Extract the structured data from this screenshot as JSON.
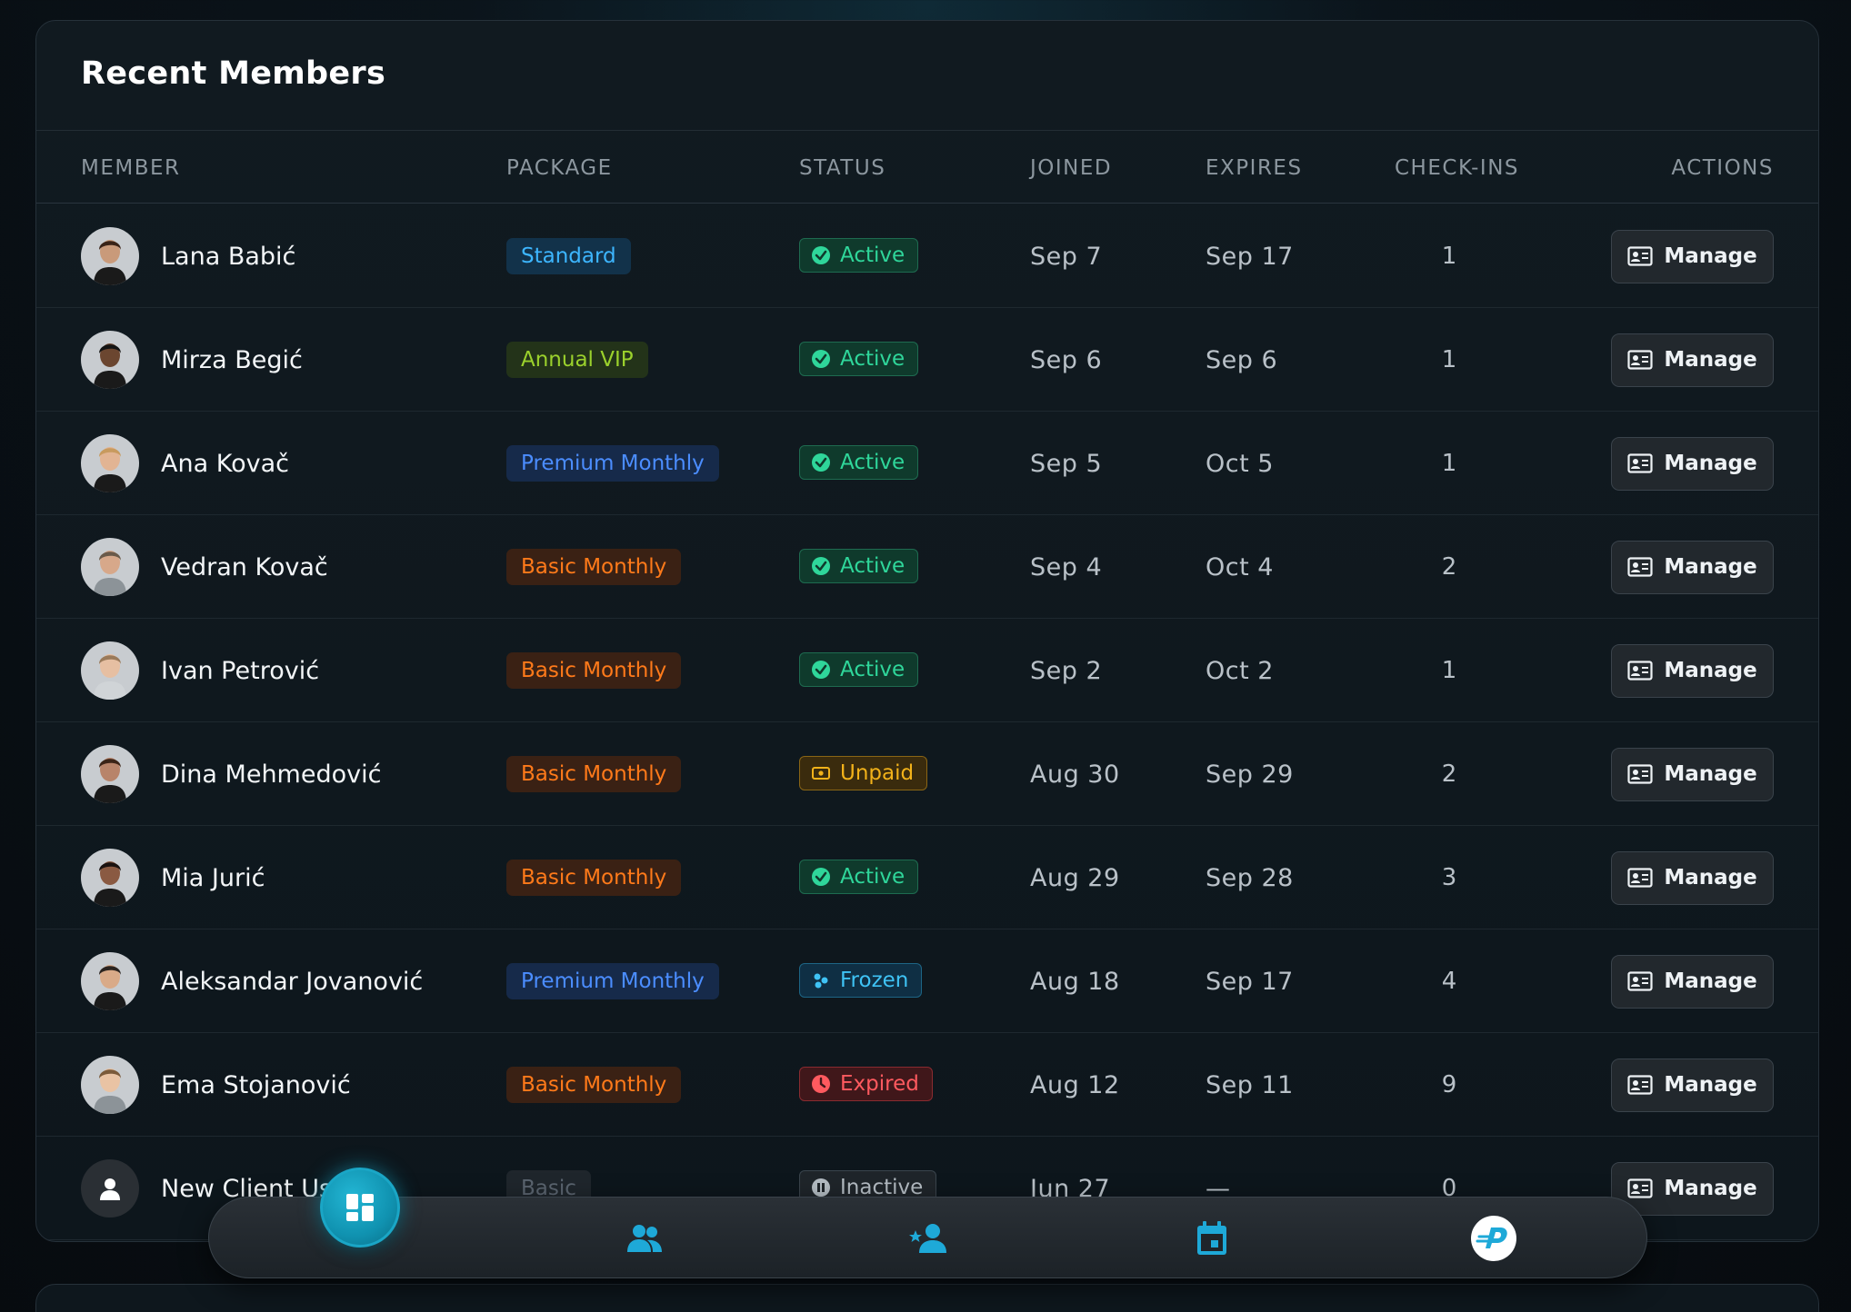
{
  "card": {
    "title": "Recent Members"
  },
  "columns": {
    "member": "MEMBER",
    "package": "PACKAGE",
    "status": "STATUS",
    "joined": "JOINED",
    "expires": "EXPIRES",
    "checkins": "CHECK-INS",
    "actions": "ACTIONS"
  },
  "rows": [
    {
      "name": "Lana Babić",
      "package": "Standard",
      "package_kind": "standard",
      "status": "Active",
      "status_kind": "active",
      "joined": "Sep 7",
      "expires": "Sep 17",
      "checkins": "1",
      "action": "Manage",
      "avatar": "avatar-photo"
    },
    {
      "name": "Mirza Begić",
      "package": "Annual VIP",
      "package_kind": "vip",
      "status": "Active",
      "status_kind": "active",
      "joined": "Sep 6",
      "expires": "Sep 6",
      "checkins": "1",
      "action": "Manage",
      "avatar": "avatar-photo"
    },
    {
      "name": "Ana Kovač",
      "package": "Premium Monthly",
      "package_kind": "premium",
      "status": "Active",
      "status_kind": "active",
      "joined": "Sep 5",
      "expires": "Oct 5",
      "checkins": "1",
      "action": "Manage",
      "avatar": "avatar-photo"
    },
    {
      "name": "Vedran Kovač",
      "package": "Basic Monthly",
      "package_kind": "basic",
      "status": "Active",
      "status_kind": "active",
      "joined": "Sep 4",
      "expires": "Oct 4",
      "checkins": "2",
      "action": "Manage",
      "avatar": "avatar-photo"
    },
    {
      "name": "Ivan Petrović",
      "package": "Basic Monthly",
      "package_kind": "basic",
      "status": "Active",
      "status_kind": "active",
      "joined": "Sep 2",
      "expires": "Oct 2",
      "checkins": "1",
      "action": "Manage",
      "avatar": "avatar-photo"
    },
    {
      "name": "Dina Mehmedović",
      "package": "Basic Monthly",
      "package_kind": "basic",
      "status": "Unpaid",
      "status_kind": "unpaid",
      "joined": "Aug 30",
      "expires": "Sep 29",
      "checkins": "2",
      "action": "Manage",
      "avatar": "avatar-photo"
    },
    {
      "name": "Mia Jurić",
      "package": "Basic Monthly",
      "package_kind": "basic",
      "status": "Active",
      "status_kind": "active",
      "joined": "Aug 29",
      "expires": "Sep 28",
      "checkins": "3",
      "action": "Manage",
      "avatar": "avatar-photo"
    },
    {
      "name": "Aleksandar Jovanović",
      "package": "Premium Monthly",
      "package_kind": "premium",
      "status": "Frozen",
      "status_kind": "frozen",
      "joined": "Aug 18",
      "expires": "Sep 17",
      "checkins": "4",
      "action": "Manage",
      "avatar": "avatar-photo"
    },
    {
      "name": "Ema Stojanović",
      "package": "Basic Monthly",
      "package_kind": "basic",
      "status": "Expired",
      "status_kind": "expired",
      "joined": "Aug 12",
      "expires": "Sep 11",
      "checkins": "9",
      "action": "Manage",
      "avatar": "avatar-photo"
    },
    {
      "name": "New Client Us",
      "package": "Basic",
      "package_kind": "basicgray",
      "status": "Inactive",
      "status_kind": "inactive",
      "joined": "Jun 27",
      "expires": "—",
      "checkins": "0",
      "action": "Manage",
      "avatar": "person-placeholder-icon"
    }
  ],
  "navbar": {
    "items": [
      "dashboard-icon",
      "members-icon",
      "add-member-icon",
      "calendar-icon",
      "brand-logo-icon"
    ],
    "active": "dashboard-icon"
  },
  "colors": {
    "accent": "#1aa6c6",
    "active": "#2fd69a",
    "unpaid": "#f2b21a",
    "frozen": "#3fc3f5",
    "expired": "#ff5a5f",
    "inactive": "#b4bcc3"
  }
}
